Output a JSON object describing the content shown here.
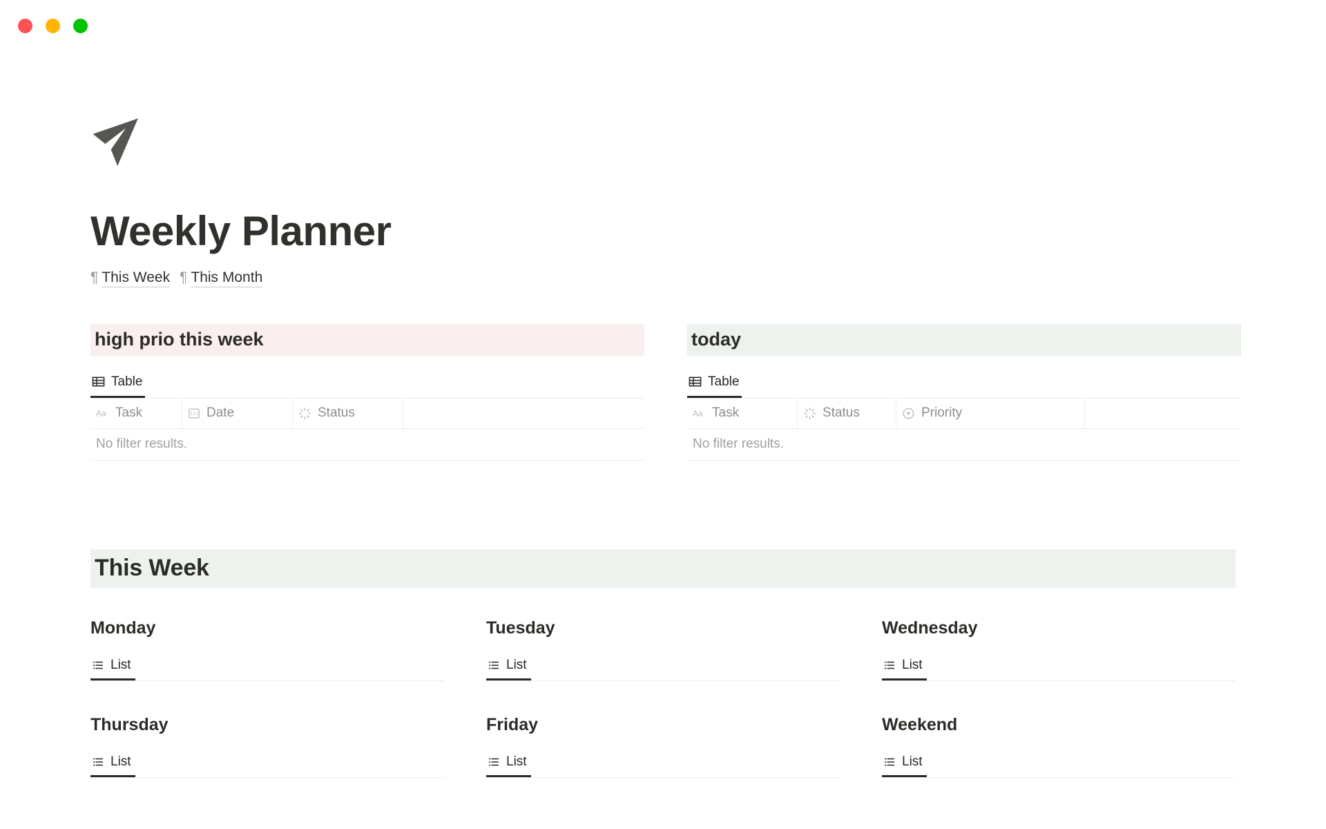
{
  "window": {
    "controls": [
      {
        "name": "close",
        "color": "#ff5252"
      },
      {
        "name": "minimize",
        "color": "#ffb400"
      },
      {
        "name": "maximize",
        "color": "#00c400"
      }
    ]
  },
  "page": {
    "icon": "paper-plane-icon",
    "title": "Weekly Planner",
    "nav": [
      {
        "marker": "¶",
        "label": "This Week"
      },
      {
        "marker": "¶",
        "label": "This Month"
      }
    ]
  },
  "databases": [
    {
      "heading": "high prio this week",
      "heading_bg": "#faeeee",
      "view_tab": {
        "icon": "table-icon",
        "label": "Table",
        "active": true
      },
      "columns": [
        {
          "icon": "title-icon",
          "label": "Task"
        },
        {
          "icon": "calendar-icon",
          "label": "Date"
        },
        {
          "icon": "status-icon",
          "label": "Status"
        },
        {
          "icon": "",
          "label": ""
        }
      ],
      "empty_text": "No filter results."
    },
    {
      "heading": "today",
      "heading_bg": "#edf2ed",
      "view_tab": {
        "icon": "table-icon",
        "label": "Table",
        "active": true
      },
      "columns": [
        {
          "icon": "title-icon",
          "label": "Task"
        },
        {
          "icon": "status-icon",
          "label": "Status"
        },
        {
          "icon": "select-icon",
          "label": "Priority"
        },
        {
          "icon": "",
          "label": ""
        }
      ],
      "empty_text": "No filter results."
    }
  ],
  "week_section": {
    "heading": "This Week",
    "heading_bg": "#edf2ed",
    "days": [
      {
        "name": "Monday",
        "view_tab": {
          "icon": "list-icon",
          "label": "List",
          "active": true
        }
      },
      {
        "name": "Tuesday",
        "view_tab": {
          "icon": "list-icon",
          "label": "List",
          "active": true
        }
      },
      {
        "name": "Wednesday",
        "view_tab": {
          "icon": "list-icon",
          "label": "List",
          "active": true
        }
      },
      {
        "name": "Thursday",
        "view_tab": {
          "icon": "list-icon",
          "label": "List",
          "active": true
        }
      },
      {
        "name": "Friday",
        "view_tab": {
          "icon": "list-icon",
          "label": "List",
          "active": true
        }
      },
      {
        "name": "Weekend",
        "view_tab": {
          "icon": "list-icon",
          "label": "List",
          "active": true
        }
      }
    ]
  }
}
